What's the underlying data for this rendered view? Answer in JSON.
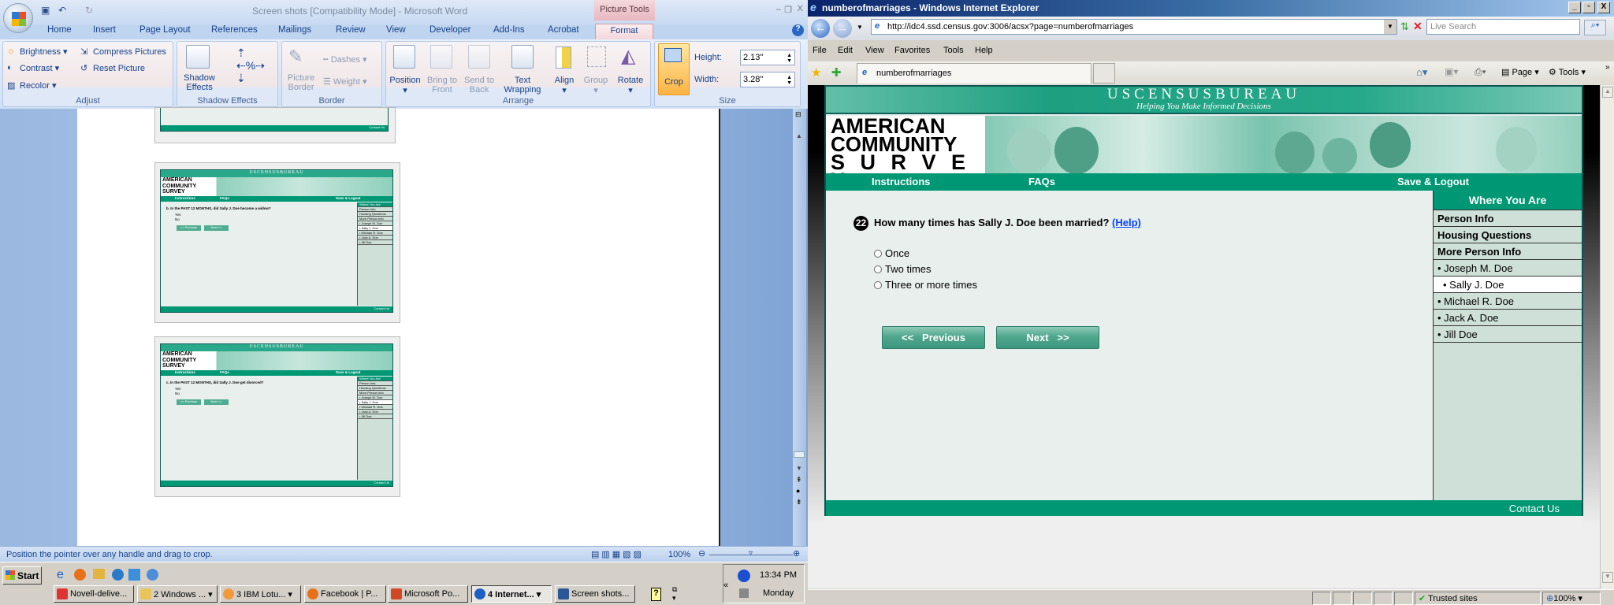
{
  "word": {
    "title": "Screen shots [Compatibility Mode] - Microsoft Word",
    "contextual_tab": "Picture Tools",
    "tabs": [
      "Home",
      "Insert",
      "Page Layout",
      "References",
      "Mailings",
      "Review",
      "View",
      "Developer",
      "Add-Ins",
      "Acrobat",
      "Format"
    ],
    "groups": {
      "adjust": {
        "label": "Adjust",
        "brightness": "Brightness",
        "contrast": "Contrast",
        "recolor": "Recolor",
        "compress": "Compress Pictures",
        "reset": "Reset Picture"
      },
      "shadow": {
        "label": "Shadow Effects",
        "button": "Shadow Effects"
      },
      "border": {
        "label": "Border",
        "picture_border": "Picture Border",
        "dashes": "Dashes",
        "weight": "Weight"
      },
      "arrange": {
        "label": "Arrange",
        "position": "Position",
        "bring": "Bring to Front",
        "send": "Send to Back",
        "wrap": "Text Wrapping",
        "align": "Align",
        "group": "Group",
        "rotate": "Rotate"
      },
      "size": {
        "label": "Size",
        "crop": "Crop",
        "height_label": "Height:",
        "height": "2.13\"",
        "width_label": "Width:",
        "width": "3.28\""
      }
    },
    "status_text": "Position the pointer over any handle and drag to crop.",
    "zoom": "100%",
    "thumbnails": [
      {
        "contact": "Contact Us"
      },
      {
        "bureau": "USCENSUSBUREAU",
        "logo": [
          "AMERICAN",
          "COMMUNITY",
          "SURVEY"
        ],
        "nav": [
          "Instructions",
          "FAQs",
          "Save & Logout"
        ],
        "question": "b. In the PAST 12 MONTHS, did Sally J. Doe become a widow?",
        "options": [
          "Yes",
          "No"
        ],
        "prev": "<<  Previous",
        "next": "Next  >>",
        "sidebar": [
          "Where You Are",
          "Person Info",
          "Housing Questions",
          "More Person Info",
          "• Joseph M. Doe",
          "• Sally J. Doe",
          "• Michael R. Doe",
          "• Jack A. Doe",
          "• Jill Doe"
        ],
        "contact": "Contact Us"
      },
      {
        "bureau": "USCENSUSBUREAU",
        "logo": [
          "AMERICAN",
          "COMMUNITY",
          "SURVEY"
        ],
        "nav": [
          "Instructions",
          "FAQs",
          "Save & Logout"
        ],
        "question": "c. In the PAST 12 MONTHS, did Sally J. Doe get divorced?",
        "options": [
          "Yes",
          "No"
        ],
        "prev": "<<  Previous",
        "next": "Next  >>",
        "sidebar": [
          "Where You Are",
          "Person Info",
          "Housing Questions",
          "More Person Info",
          "• Joseph M. Doe",
          "• Sally J. Doe",
          "• Michael R. Doe",
          "• Jack A. Doe",
          "• Jill Doe"
        ],
        "contact": "Contact Us"
      }
    ]
  },
  "taskbar": {
    "start": "Start",
    "tasks": [
      "Novell-delive...",
      "2 Windows ...",
      "3 IBM Lotu...",
      "Facebook | P...",
      "Microsoft Po...",
      "4 Internet...",
      "Screen shots..."
    ],
    "active_task": "4 Internet...",
    "time": "13:34 PM",
    "day": "Monday"
  },
  "ie": {
    "title": "numberofmarriages - Windows Internet Explorer",
    "url": "http://idc4.ssd.census.gov:3006/acsx?page=numberofmarriages",
    "search_placeholder": "Live Search",
    "menu": [
      "File",
      "Edit",
      "View",
      "Favorites",
      "Tools",
      "Help"
    ],
    "tab_title": "numberofmarriages",
    "toolbar": {
      "page": "Page",
      "tools": "Tools"
    },
    "status": {
      "zone": "Trusted sites",
      "zoom": "100%"
    }
  },
  "census": {
    "bureau": "USCENSUSBUREAU",
    "tagline": "Helping You Make Informed Decisions",
    "logo": [
      "AMERICAN",
      "COMMUNITY",
      "S U R V E Y"
    ],
    "nav": {
      "instructions": "Instructions",
      "faqs": "FAQs",
      "save_logout": "Save & Logout"
    },
    "question_number": "22",
    "question": "How many times has Sally J. Doe been married?",
    "help": "(Help)",
    "options": [
      "Once",
      "Two times",
      "Three or more times"
    ],
    "prev": "<<   Previous",
    "next": "Next   >>",
    "sidebar": {
      "title": "Where You Are",
      "sections": [
        "Person Info",
        "Housing Questions",
        "More Person Info"
      ],
      "people": [
        "• Joseph M. Doe",
        "• Sally J. Doe",
        "• Michael R. Doe",
        "• Jack A. Doe",
        "• Jill Doe"
      ],
      "current": "• Sally J. Doe"
    },
    "contact": "Contact Us",
    "colors": {
      "green": "#009775",
      "header": "#26a88a",
      "content": "#e8efec",
      "sidebar": "#cfe0d9"
    }
  }
}
